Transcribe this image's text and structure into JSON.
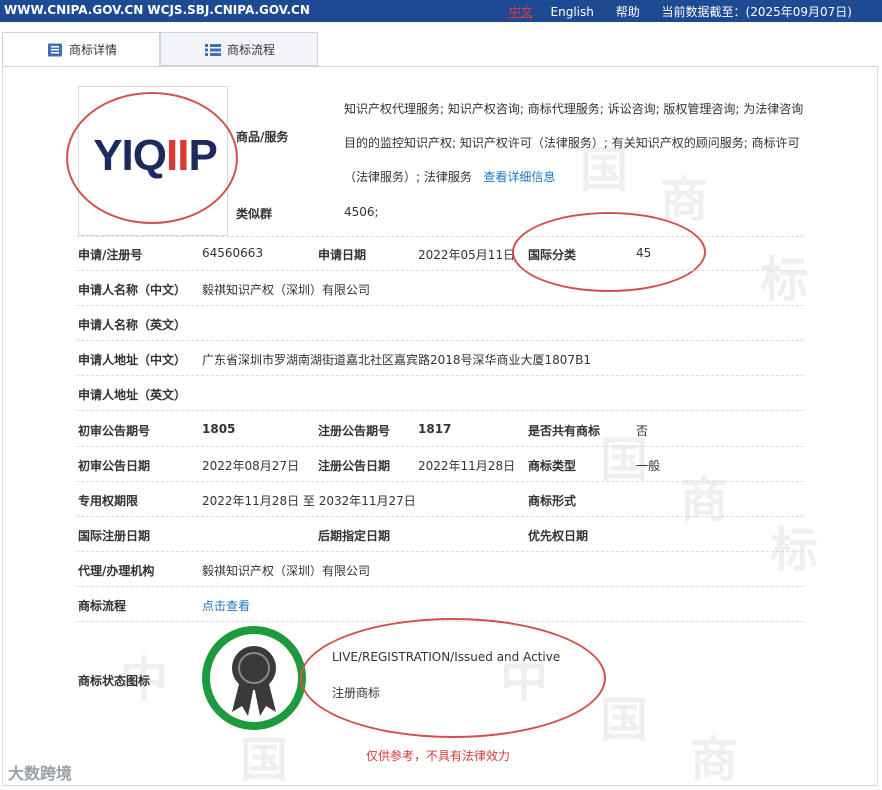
{
  "topbar": {
    "domains": "WWW.CNIPA.GOV.CN WCJS.SBJ.CNIPA.GOV.CN",
    "lang_cn": "中文",
    "lang_en": "English",
    "help": "帮助",
    "data_date": "当前数据截至：(2025年09月07日)"
  },
  "tabs": [
    {
      "label": "商标详情",
      "icon": "document-icon",
      "active": true
    },
    {
      "label": "商标流程",
      "icon": "list-icon",
      "active": false
    }
  ],
  "logo": {
    "text_a": "YI",
    "text_b": "Q",
    "text_c": "II",
    "text_d": "P"
  },
  "details": {
    "goods_label": "商品/服务",
    "goods_text": "知识产权代理服务; 知识产权咨询; 商标代理服务; 诉讼咨询; 版权管理咨询; 为法律咨询目的的监控知识产权; 知识产权许可（法律服务）; 有关知识产权的顾问服务; 商标许可（法律服务）; 法律服务",
    "goods_link": "查看详细信息",
    "similar_label": "类似群",
    "similar_value": "4506;",
    "reg_no_label": "申请/注册号",
    "reg_no_value": "64560663",
    "apply_date_label": "申请日期",
    "apply_date_value": "2022年05月11日",
    "intl_class_label": "国际分类",
    "intl_class_value": "45",
    "applicant_cn_label": "申请人名称（中文）",
    "applicant_cn_value": "毅祺知识产权（深圳）有限公司",
    "applicant_en_label": "申请人名称（英文）",
    "address_cn_label": "申请人地址（中文）",
    "address_cn_value": "广东省深圳市罗湖南湖街道嘉北社区嘉宾路2018号深华商业大厦1807B1",
    "address_en_label": "申请人地址（英文）",
    "prelim_no_label": "初审公告期号",
    "prelim_no_value": "1805",
    "reg_notice_no_label": "注册公告期号",
    "reg_notice_no_value": "1817",
    "shared_label": "是否共有商标",
    "shared_value": "否",
    "prelim_date_label": "初审公告日期",
    "prelim_date_value": "2022年08月27日",
    "reg_notice_date_label": "注册公告日期",
    "reg_notice_date_value": "2022年11月28日",
    "mark_type_label": "商标类型",
    "mark_type_value": "一般",
    "exclusive_label": "专用权期限",
    "exclusive_value": "2022年11月28日 至 2032年11月27日",
    "mark_form_label": "商标形式",
    "intl_reg_date_label": "国际注册日期",
    "later_date_label": "后期指定日期",
    "priority_date_label": "优先权日期",
    "agent_label": "代理/办理机构",
    "agent_value": "毅祺知识产权（深圳）有限公司",
    "flow_label": "商标流程",
    "flow_link": "点击查看",
    "status_label": "商标状态图标",
    "status_en": "LIVE/REGISTRATION/Issued and Active",
    "status_cn": "注册商标"
  },
  "disclaimer": "仅供参考，不具有法律效力",
  "brand": "大数跨境",
  "colors": {
    "topbar": "#1d4a93",
    "link": "#2076c5",
    "highlight": "#d5504a",
    "badge": "#1e9a3e"
  }
}
